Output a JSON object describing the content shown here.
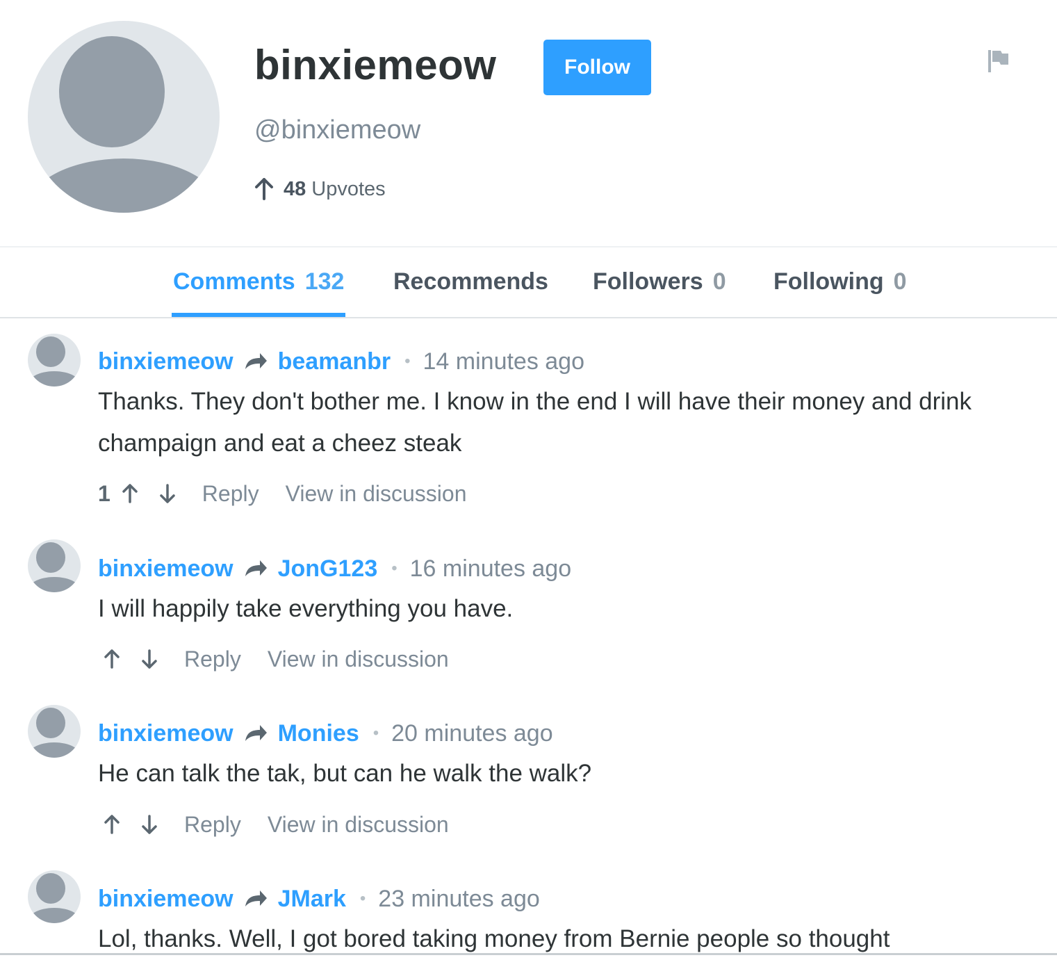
{
  "profile": {
    "username": "binxiemeow",
    "handle": "@binxiemeow",
    "follow_label": "Follow",
    "upvotes_count": "48",
    "upvotes_label": "Upvotes"
  },
  "tabs": [
    {
      "label": "Comments",
      "count": "132"
    },
    {
      "label": "Recommends",
      "count": ""
    },
    {
      "label": "Followers",
      "count": "0"
    },
    {
      "label": "Following",
      "count": "0"
    }
  ],
  "comments": [
    {
      "author": "binxiemeow",
      "target": "beamanbr",
      "time": "14 minutes ago",
      "text": "Thanks. They don't bother me. I know in the end I will have their money and drink champaign and eat a cheez steak",
      "votes": "1",
      "reply_label": "Reply",
      "view_label": "View in discussion"
    },
    {
      "author": "binxiemeow",
      "target": "JonG123",
      "time": "16 minutes ago",
      "text": "I will happily take everything you have.",
      "votes": "",
      "reply_label": "Reply",
      "view_label": "View in discussion"
    },
    {
      "author": "binxiemeow",
      "target": "Monies",
      "time": "20 minutes ago",
      "text": "He can talk the tak, but can he walk the walk?",
      "votes": "",
      "reply_label": "Reply",
      "view_label": "View in discussion"
    },
    {
      "author": "binxiemeow",
      "target": "JMark",
      "time": "23 minutes ago",
      "text": "Lol, thanks. Well, I got bored taking money from Bernie people so thought",
      "votes": "",
      "reply_label": "Reply",
      "view_label": "View in discussion"
    }
  ],
  "colors": {
    "accent": "#2e9fff",
    "muted_text": "#7d8a96",
    "avatar_bg": "#e1e6ea",
    "avatar_fg": "#949ea8"
  },
  "icons": {
    "flag": "flag-icon",
    "upvote": "arrow-up-icon",
    "downvote": "arrow-down-icon",
    "reply_to": "reply-arrow-icon"
  }
}
